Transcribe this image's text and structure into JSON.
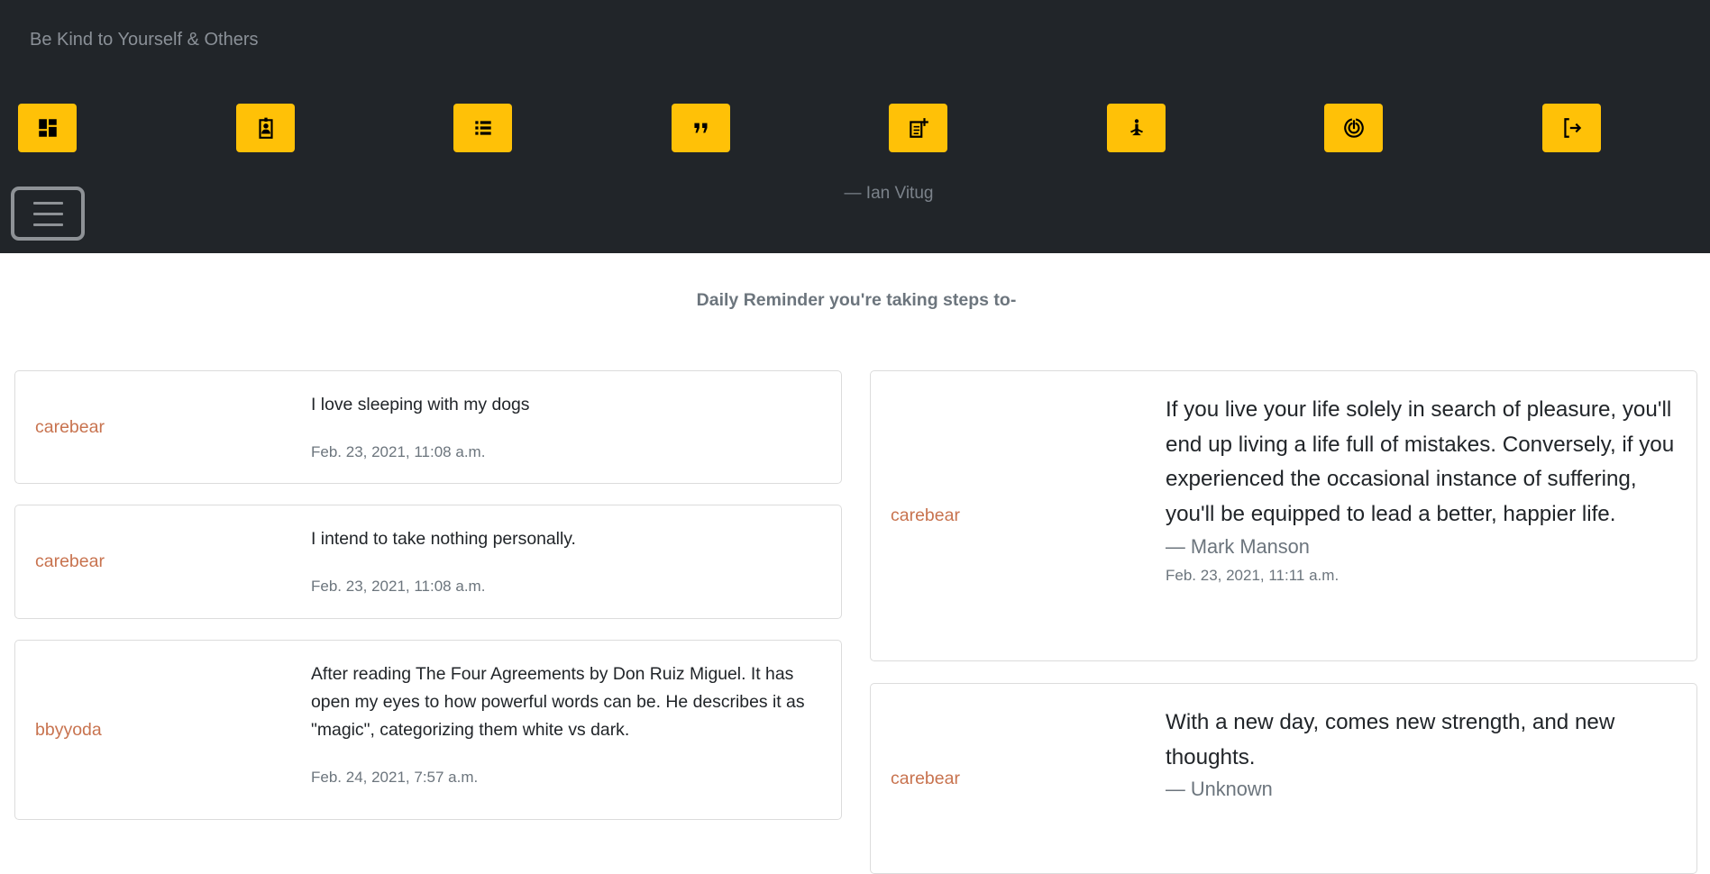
{
  "navbar": {
    "brand": "Be Kind to Yourself & Others",
    "buttons": [
      {
        "icon": "dashboard-icon"
      },
      {
        "icon": "profile-badge-icon"
      },
      {
        "icon": "list-icon"
      },
      {
        "icon": "quote-icon"
      },
      {
        "icon": "add-note-icon"
      },
      {
        "icon": "meditation-icon"
      },
      {
        "icon": "target-icon"
      },
      {
        "icon": "logout-icon"
      }
    ],
    "author": "— Ian Vitug",
    "accent": "#ffc107",
    "background": "#212529"
  },
  "main": {
    "heading": "Daily Reminder you're taking steps to-",
    "intentions": [
      {
        "user": "carebear",
        "text": "I love sleeping with my dogs",
        "date": "Feb. 23, 2021, 11:08 a.m."
      },
      {
        "user": "carebear",
        "text": "I intend to take nothing personally.",
        "date": "Feb. 23, 2021, 11:08 a.m."
      },
      {
        "user": "bbyyoda",
        "text": "After reading The Four Agreements by Don Ruiz Miguel. It has open my eyes to how powerful words can be. He describes it as \"magic\", categorizing them white vs dark.",
        "date": "Feb. 24, 2021, 7:57 a.m."
      }
    ],
    "quotes": [
      {
        "user": "carebear",
        "text": "If you live your life solely in search of pleasure, you'll end up living a life full of mistakes. Conversely, if you experienced the occasional instance of suffering, you'll be equipped to lead a better, happier life.",
        "author": "— Mark Manson",
        "date": "Feb. 23, 2021, 11:11 a.m."
      },
      {
        "user": "carebear",
        "text": "With a new day, comes new strength, and new thoughts.",
        "author": "— Unknown",
        "date": ""
      }
    ]
  }
}
